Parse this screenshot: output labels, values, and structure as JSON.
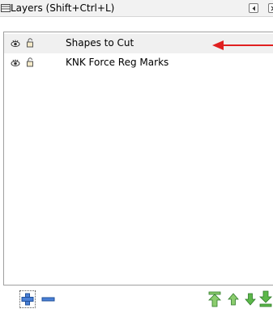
{
  "panel": {
    "title": "Layers (Shift+Ctrl+L)"
  },
  "layers": [
    {
      "name": "Shapes to Cut",
      "selected": true
    },
    {
      "name": "KNK Force Reg Marks",
      "selected": false
    }
  ],
  "icons": {
    "panel": "layers-panel-icon",
    "visibility": "eye-icon",
    "lock": "unlocked-padlock-icon",
    "add": "plus-icon",
    "remove": "minus-icon",
    "raise_top": "raise-to-top-icon",
    "raise": "raise-icon",
    "lower": "lower-icon",
    "lower_bottom": "lower-to-bottom-icon"
  },
  "colors": {
    "selected_row": "#f0f0f0",
    "annotation_arrow": "#e02020",
    "add_icon": "#3a6fc4",
    "move_icons": "#3aa33a"
  }
}
